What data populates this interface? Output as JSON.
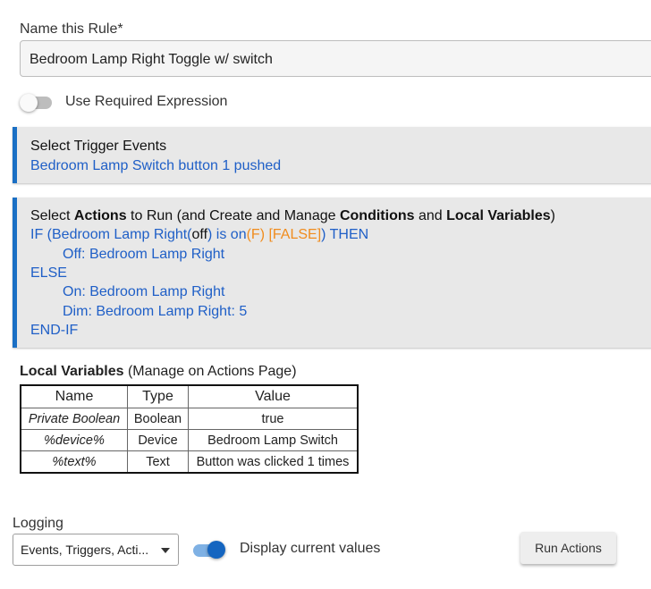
{
  "rule_name": {
    "label": "Name this Rule*",
    "value": "Bedroom Lamp Right Toggle w/ switch"
  },
  "required_expression": {
    "label": "Use Required Expression",
    "enabled": false
  },
  "triggers": {
    "heading": "Select Trigger Events",
    "event": "Bedroom Lamp Switch button 1 pushed"
  },
  "actions": {
    "heading_prefix": "Select ",
    "heading_bold1": "Actions",
    "heading_mid1": " to Run (and Create and Manage ",
    "heading_bold2": "Conditions",
    "heading_mid2": " and ",
    "heading_bold3": "Local Variables",
    "heading_suffix": ")",
    "if_prefix": "IF (Bedroom Lamp Right(",
    "if_state": "off",
    "if_mid": ") is on",
    "if_eval": "(F) [FALSE]",
    "if_suffix": ") THEN",
    "off_action": "Off: Bedroom Lamp Right",
    "else": "ELSE",
    "on_action": "On: Bedroom Lamp Right",
    "dim_action": "Dim: Bedroom Lamp Right: 5",
    "endif": "END-IF"
  },
  "local_variables": {
    "title": "Local Variables",
    "subtitle": " (Manage on Actions Page)",
    "columns": [
      "Name",
      "Type",
      "Value"
    ],
    "rows": [
      {
        "name": "Private Boolean",
        "type": "Boolean",
        "value": "true"
      },
      {
        "name": "%device%",
        "type": "Device",
        "value": "Bedroom Lamp Switch"
      },
      {
        "name": "%text%",
        "type": "Text",
        "value": "Button was clicked 1 times"
      }
    ]
  },
  "logging": {
    "label": "Logging",
    "selected": "Events, Triggers, Acti...",
    "display_label": "Display current values",
    "display_enabled": true
  },
  "run_actions_label": "Run Actions",
  "colors": {
    "accent_blue": "#1a6fc4",
    "link_blue": "#1f5fc7",
    "false_orange": "#f08c1e",
    "toggle_on": "#1565c0"
  }
}
